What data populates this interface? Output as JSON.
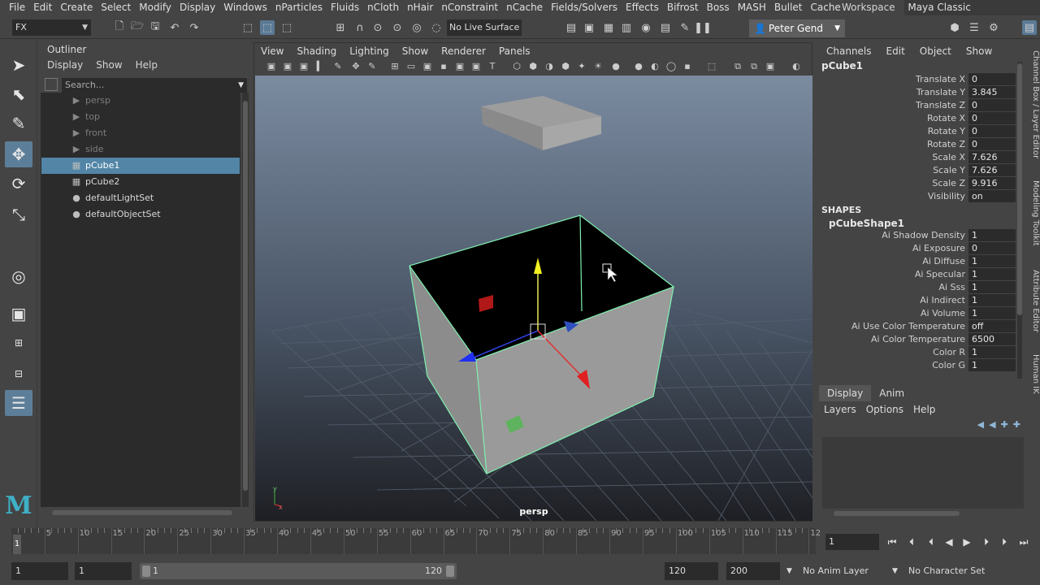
{
  "menubar": {
    "items": [
      "File",
      "Edit",
      "Create",
      "Select",
      "Modify",
      "Display",
      "Windows",
      "nParticles",
      "Fluids",
      "nCloth",
      "nHair",
      "nConstraint",
      "nCache",
      "Fields/Solvers",
      "Effects",
      "Bifrost",
      "Boss",
      "MASH",
      "Bullet",
      "Cache"
    ],
    "workspace_label": "Workspace :",
    "workspace_value": "Maya Classic"
  },
  "statusline": {
    "mode": "FX",
    "live_surface": "No Live Surface",
    "user": "Peter Gend"
  },
  "outliner": {
    "title": "Outliner",
    "menu": [
      "Display",
      "Show",
      "Help"
    ],
    "search_placeholder": "Search...",
    "items": [
      {
        "label": "persp",
        "icon": "camera-icon",
        "dim": true
      },
      {
        "label": "top",
        "icon": "camera-icon",
        "dim": true
      },
      {
        "label": "front",
        "icon": "camera-icon",
        "dim": true
      },
      {
        "label": "side",
        "icon": "camera-icon",
        "dim": true
      },
      {
        "label": "pCube1",
        "icon": "mesh-icon",
        "selected": true
      },
      {
        "label": "pCube2",
        "icon": "mesh-icon"
      },
      {
        "label": "defaultLightSet",
        "icon": "set-icon"
      },
      {
        "label": "defaultObjectSet",
        "icon": "set-icon"
      }
    ]
  },
  "viewport": {
    "menu": [
      "View",
      "Shading",
      "Lighting",
      "Show",
      "Renderer",
      "Panels"
    ],
    "camera": "persp",
    "axis_y": "y",
    "axis_x": "x",
    "colors": {
      "bg_top": "#7b8ba0",
      "bg_bottom": "#1e1f24",
      "wire": "#7ff0b0"
    }
  },
  "channelbox": {
    "menu": [
      "Channels",
      "Edit",
      "Object",
      "Show"
    ],
    "object": "pCube1",
    "attrs": [
      {
        "label": "Translate X",
        "value": "0"
      },
      {
        "label": "Translate Y",
        "value": "3.845"
      },
      {
        "label": "Translate Z",
        "value": "0"
      },
      {
        "label": "Rotate X",
        "value": "0"
      },
      {
        "label": "Rotate Y",
        "value": "0"
      },
      {
        "label": "Rotate Z",
        "value": "0"
      },
      {
        "label": "Scale X",
        "value": "7.626"
      },
      {
        "label": "Scale Y",
        "value": "7.626"
      },
      {
        "label": "Scale Z",
        "value": "9.916"
      },
      {
        "label": "Visibility",
        "value": "on"
      }
    ],
    "shapes_header": "SHAPES",
    "shape_name": "pCubeShape1",
    "shape_attrs": [
      {
        "label": "Ai Shadow Density",
        "value": "1"
      },
      {
        "label": "Ai Exposure",
        "value": "0"
      },
      {
        "label": "Ai Diffuse",
        "value": "1"
      },
      {
        "label": "Ai Specular",
        "value": "1"
      },
      {
        "label": "Ai Sss",
        "value": "1"
      },
      {
        "label": "Ai Indirect",
        "value": "1"
      },
      {
        "label": "Ai Volume",
        "value": "1"
      },
      {
        "label": "Ai Use Color Temperature",
        "value": "off"
      },
      {
        "label": "Ai Color Temperature",
        "value": "6500"
      },
      {
        "label": "Color R",
        "value": "1"
      },
      {
        "label": "Color G",
        "value": "1"
      }
    ]
  },
  "side_tabs": [
    "Channel Box / Layer Editor",
    "Modeling Toolkit",
    "Attribute Editor",
    "Human IK"
  ],
  "layers": {
    "tabs": [
      "Display",
      "Anim"
    ],
    "menu": [
      "Layers",
      "Options",
      "Help"
    ]
  },
  "timeslider": {
    "ticks": [
      "5",
      "10",
      "15",
      "20",
      "25",
      "30",
      "35",
      "40",
      "45",
      "50",
      "55",
      "60",
      "65",
      "70",
      "75",
      "80",
      "85",
      "90",
      "95",
      "100",
      "105",
      "110",
      "115",
      "12"
    ],
    "current": "1",
    "frame": "1"
  },
  "rangebar": {
    "start": "1",
    "start2": "1",
    "slider_start": "1",
    "slider_end": "120",
    "end": "120",
    "end2": "200",
    "anim_layer": "No Anim Layer",
    "char_set": "No Character Set"
  }
}
